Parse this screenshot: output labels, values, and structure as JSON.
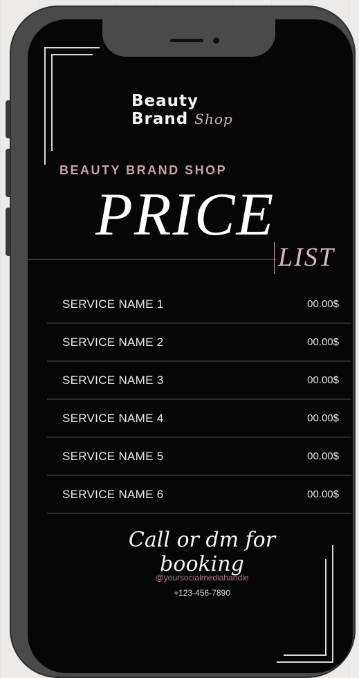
{
  "flyer": {
    "logo_line1": "Beauty",
    "logo_line2": "Brand",
    "logo_script": "Shop",
    "brand_name": "BEAUTY BRAND SHOP",
    "title": "PRICE",
    "subtitle": "LIST",
    "services": [
      {
        "name": "SERVICE NAME 1",
        "price": "00.00$"
      },
      {
        "name": "SERVICE NAME 2",
        "price": "00.00$"
      },
      {
        "name": "SERVICE NAME 3",
        "price": "00.00$"
      },
      {
        "name": "SERVICE NAME 4",
        "price": "00.00$"
      },
      {
        "name": "SERVICE NAME 5",
        "price": "00.00$"
      },
      {
        "name": "SERVICE NAME 6",
        "price": "00.00$"
      }
    ],
    "booking_text": "Call or dm for booking",
    "handle": "@yoursocialmediahandle",
    "phone": "+123-456-7890"
  },
  "colors": {
    "screen_bg": "#060606",
    "accent_rose": "#c9a3a6",
    "phone_frame": "#4a4a4a"
  }
}
